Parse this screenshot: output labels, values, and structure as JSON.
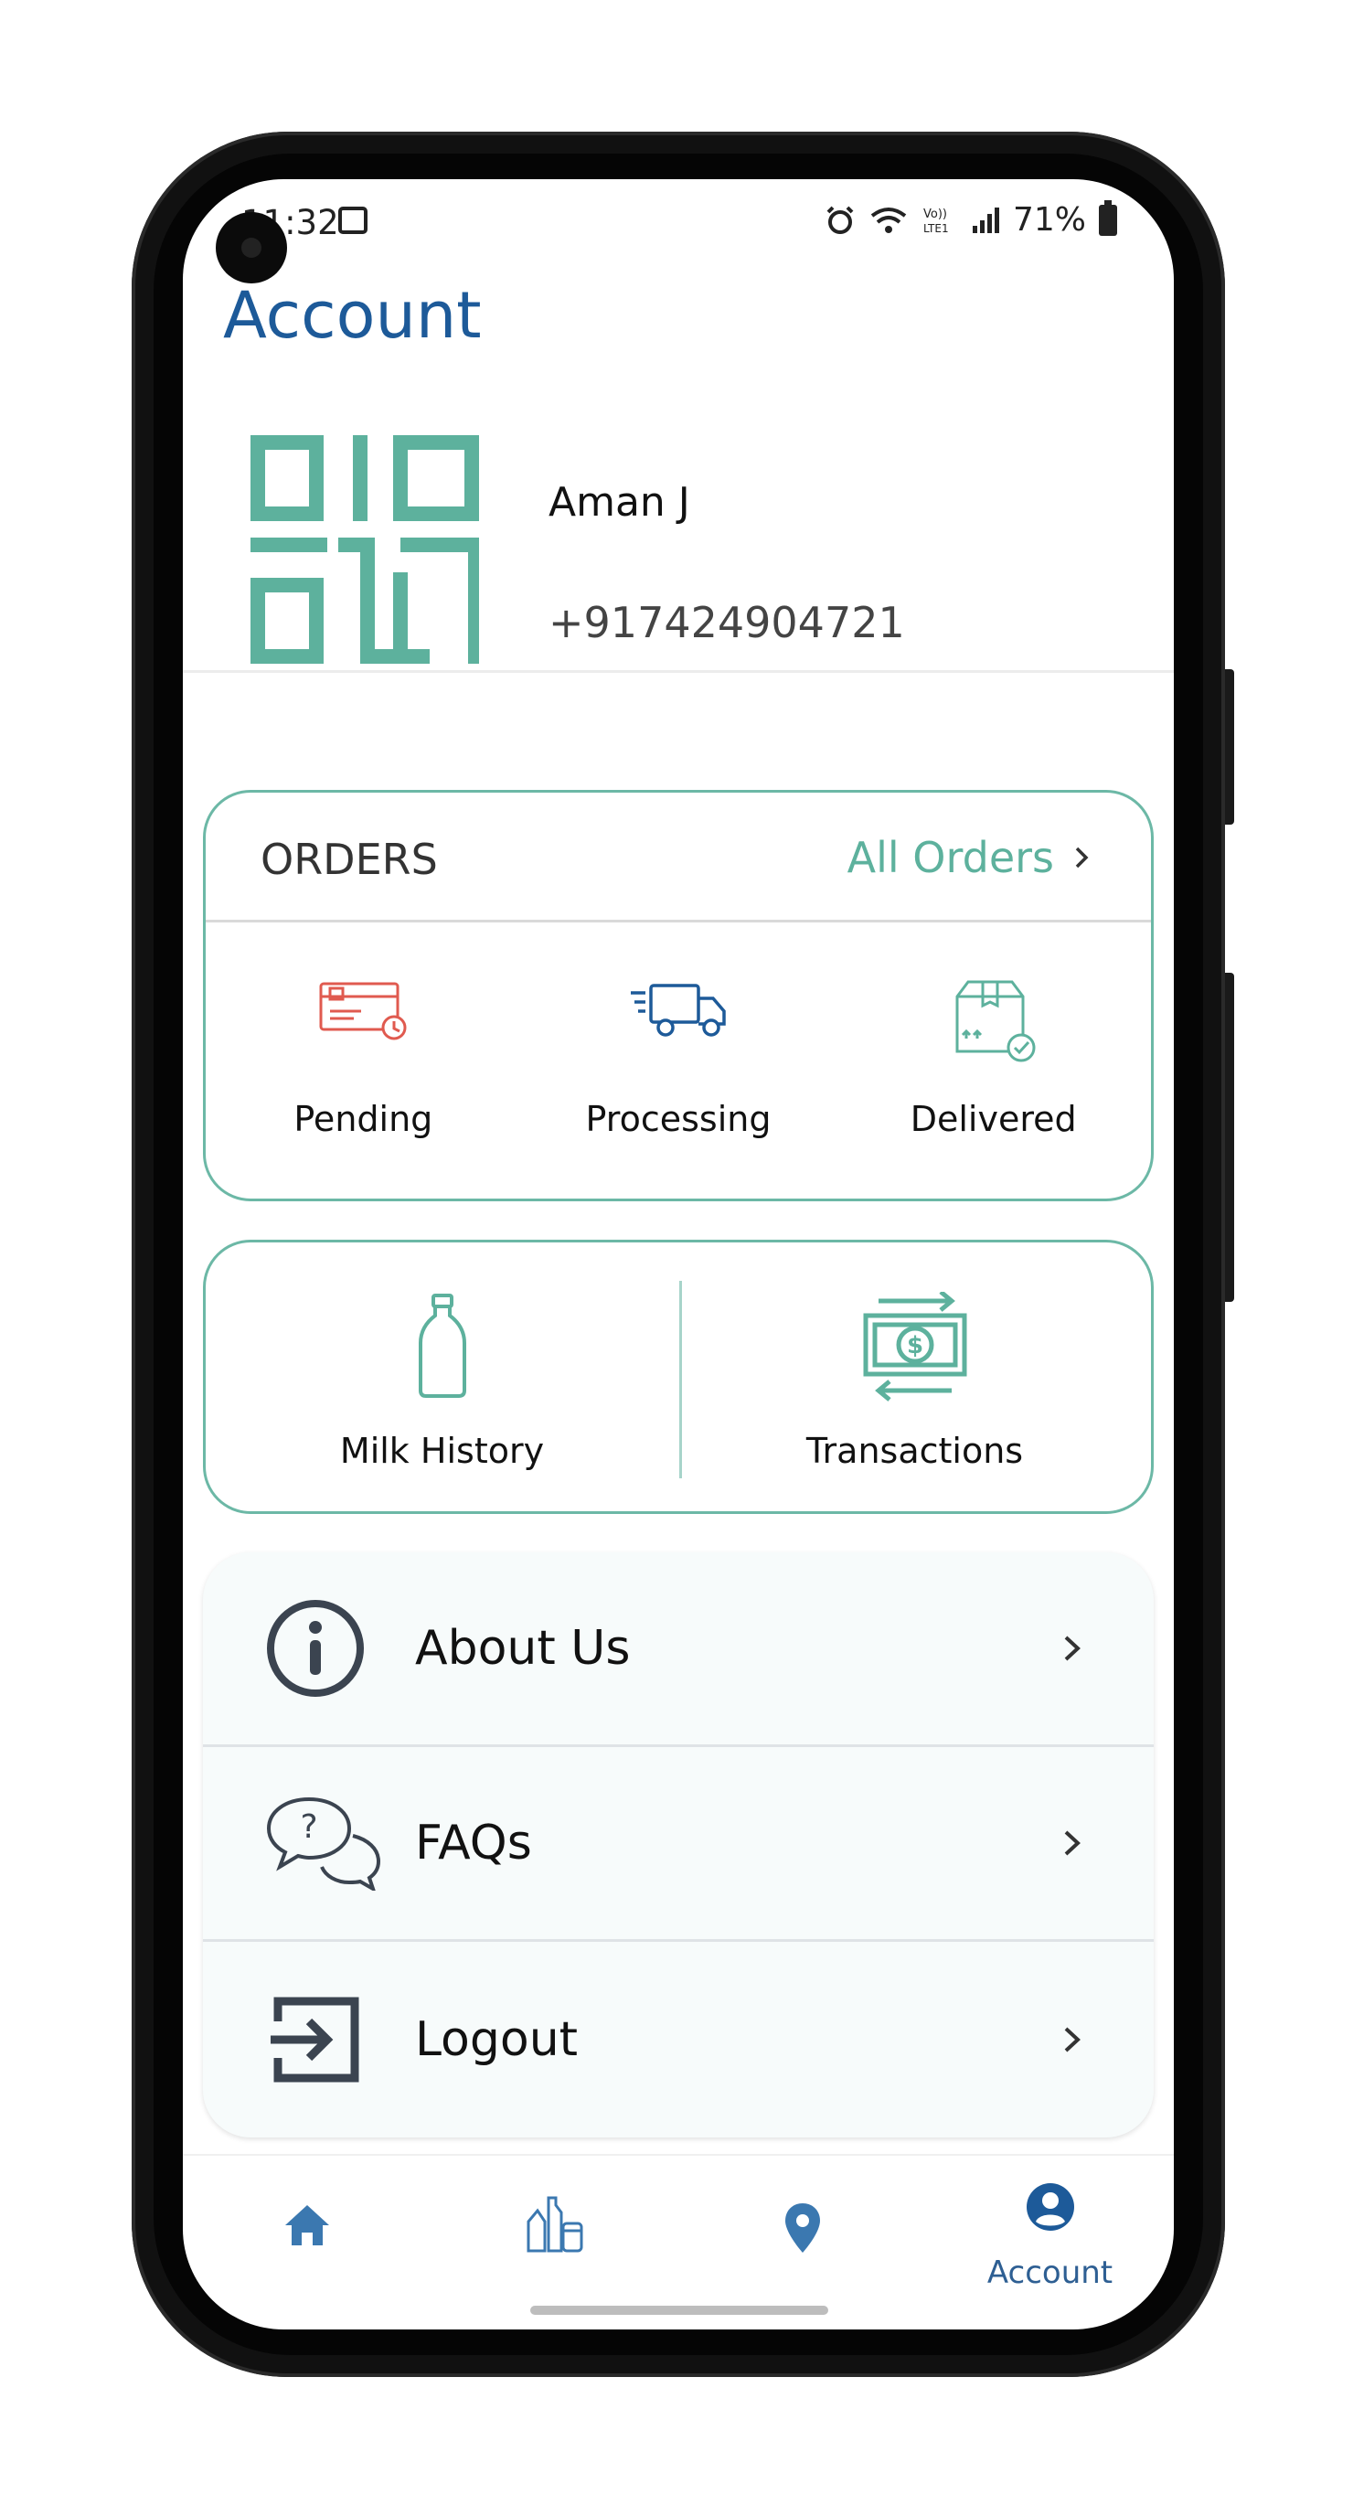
{
  "status_bar": {
    "time": "11:32",
    "battery_text": "71%"
  },
  "header": {
    "title": "Account"
  },
  "profile": {
    "name": "Aman J",
    "phone": "+917424904721"
  },
  "orders": {
    "title": "ORDERS",
    "all_orders_label": "All Orders",
    "items": [
      {
        "label": "Pending",
        "icon": "card-clock-icon"
      },
      {
        "label": "Processing",
        "icon": "truck-icon"
      },
      {
        "label": "Delivered",
        "icon": "box-check-icon"
      }
    ]
  },
  "history": {
    "items": [
      {
        "label": "Milk History",
        "icon": "milk-bottle-icon"
      },
      {
        "label": "Transactions",
        "icon": "money-transfer-icon"
      }
    ]
  },
  "menu": {
    "items": [
      {
        "label": "About Us",
        "icon": "info-icon"
      },
      {
        "label": "FAQs",
        "icon": "chat-question-icon"
      },
      {
        "label": "Logout",
        "icon": "logout-icon"
      }
    ]
  },
  "bottom_nav": {
    "items": [
      {
        "label": "",
        "icon": "home-icon"
      },
      {
        "label": "",
        "icon": "products-icon"
      },
      {
        "label": "",
        "icon": "location-icon"
      },
      {
        "label": "Account",
        "icon": "account-icon"
      }
    ]
  },
  "colors": {
    "title_blue": "#1d5a99",
    "accent_teal": "#5db19d",
    "nav_blue": "#2e5f93",
    "pending_red": "#e05a4f"
  }
}
